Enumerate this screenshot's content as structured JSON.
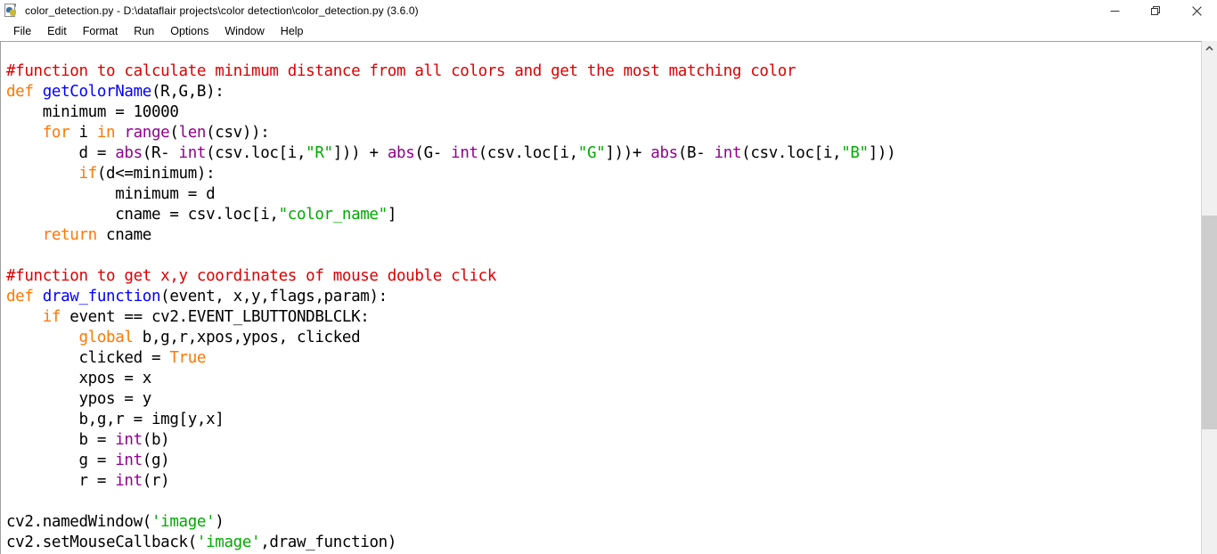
{
  "window": {
    "title": "color_detection.py - D:\\dataflair projects\\color detection\\color_detection.py (3.6.0)",
    "icon": "python-file-icon",
    "controls": {
      "minimize": "minimize-icon",
      "restore": "restore-icon",
      "close": "close-icon"
    }
  },
  "menubar": {
    "items": [
      {
        "label": "File"
      },
      {
        "label": "Edit"
      },
      {
        "label": "Format"
      },
      {
        "label": "Run"
      },
      {
        "label": "Options"
      },
      {
        "label": "Window"
      },
      {
        "label": "Help"
      }
    ]
  },
  "scrollbar": {
    "up_arrow": "chevron-up-icon",
    "thumb_top_pct": 32,
    "thumb_height_pct": 43
  },
  "colors": {
    "comment": "#dd0000",
    "keyword": "#ff7700",
    "definition": "#0000ff",
    "builtin": "#900090",
    "string": "#00aa00",
    "plain": "#000000",
    "background": "#ffffff"
  },
  "editor": {
    "language": "python",
    "lines": [
      [
        {
          "t": "#function to calculate minimum distance from all colors and get the most matching color",
          "c": "comment"
        }
      ],
      [
        {
          "t": "def",
          "c": "keyword"
        },
        {
          "t": " ",
          "c": "plain"
        },
        {
          "t": "getColorName",
          "c": "def"
        },
        {
          "t": "(R,G,B):",
          "c": "plain"
        }
      ],
      [
        {
          "t": "    minimum = 10000",
          "c": "plain"
        }
      ],
      [
        {
          "t": "    ",
          "c": "plain"
        },
        {
          "t": "for",
          "c": "keyword"
        },
        {
          "t": " i ",
          "c": "plain"
        },
        {
          "t": "in",
          "c": "keyword"
        },
        {
          "t": " ",
          "c": "plain"
        },
        {
          "t": "range",
          "c": "builtin"
        },
        {
          "t": "(",
          "c": "plain"
        },
        {
          "t": "len",
          "c": "builtin"
        },
        {
          "t": "(csv)):",
          "c": "plain"
        }
      ],
      [
        {
          "t": "        d = ",
          "c": "plain"
        },
        {
          "t": "abs",
          "c": "builtin"
        },
        {
          "t": "(R- ",
          "c": "plain"
        },
        {
          "t": "int",
          "c": "builtin"
        },
        {
          "t": "(csv.loc[i,",
          "c": "plain"
        },
        {
          "t": "\"R\"",
          "c": "string"
        },
        {
          "t": "])) + ",
          "c": "plain"
        },
        {
          "t": "abs",
          "c": "builtin"
        },
        {
          "t": "(G- ",
          "c": "plain"
        },
        {
          "t": "int",
          "c": "builtin"
        },
        {
          "t": "(csv.loc[i,",
          "c": "plain"
        },
        {
          "t": "\"G\"",
          "c": "string"
        },
        {
          "t": "]))+ ",
          "c": "plain"
        },
        {
          "t": "abs",
          "c": "builtin"
        },
        {
          "t": "(B- ",
          "c": "plain"
        },
        {
          "t": "int",
          "c": "builtin"
        },
        {
          "t": "(csv.loc[i,",
          "c": "plain"
        },
        {
          "t": "\"B\"",
          "c": "string"
        },
        {
          "t": "]))",
          "c": "plain"
        }
      ],
      [
        {
          "t": "        ",
          "c": "plain"
        },
        {
          "t": "if",
          "c": "keyword"
        },
        {
          "t": "(d<=minimum):",
          "c": "plain"
        }
      ],
      [
        {
          "t": "            minimum = d",
          "c": "plain"
        }
      ],
      [
        {
          "t": "            cname = csv.loc[i,",
          "c": "plain"
        },
        {
          "t": "\"color_name\"",
          "c": "string"
        },
        {
          "t": "]",
          "c": "plain"
        }
      ],
      [
        {
          "t": "    ",
          "c": "plain"
        },
        {
          "t": "return",
          "c": "keyword"
        },
        {
          "t": " cname",
          "c": "plain"
        }
      ],
      [
        {
          "t": "",
          "c": "plain"
        }
      ],
      [
        {
          "t": "#function to get x,y coordinates of mouse double click",
          "c": "comment"
        }
      ],
      [
        {
          "t": "def",
          "c": "keyword"
        },
        {
          "t": " ",
          "c": "plain"
        },
        {
          "t": "draw_function",
          "c": "def"
        },
        {
          "t": "(event, x,y,flags,param):",
          "c": "plain"
        }
      ],
      [
        {
          "t": "    ",
          "c": "plain"
        },
        {
          "t": "if",
          "c": "keyword"
        },
        {
          "t": " event == cv2.EVENT_LBUTTONDBLCLK:",
          "c": "plain"
        }
      ],
      [
        {
          "t": "        ",
          "c": "plain"
        },
        {
          "t": "global",
          "c": "keyword"
        },
        {
          "t": " b,g,r,xpos,ypos, clicked",
          "c": "plain"
        }
      ],
      [
        {
          "t": "        clicked = ",
          "c": "plain"
        },
        {
          "t": "True",
          "c": "keyword"
        }
      ],
      [
        {
          "t": "        xpos = x",
          "c": "plain"
        }
      ],
      [
        {
          "t": "        ypos = y",
          "c": "plain"
        }
      ],
      [
        {
          "t": "        b,g,r = img[y,x]",
          "c": "plain"
        }
      ],
      [
        {
          "t": "        b = ",
          "c": "plain"
        },
        {
          "t": "int",
          "c": "builtin"
        },
        {
          "t": "(b)",
          "c": "plain"
        }
      ],
      [
        {
          "t": "        g = ",
          "c": "plain"
        },
        {
          "t": "int",
          "c": "builtin"
        },
        {
          "t": "(g)",
          "c": "plain"
        }
      ],
      [
        {
          "t": "        r = ",
          "c": "plain"
        },
        {
          "t": "int",
          "c": "builtin"
        },
        {
          "t": "(r)",
          "c": "plain"
        }
      ],
      [
        {
          "t": "",
          "c": "plain"
        }
      ],
      [
        {
          "t": "cv2.namedWindow(",
          "c": "plain"
        },
        {
          "t": "'image'",
          "c": "string"
        },
        {
          "t": ")",
          "c": "plain"
        }
      ],
      [
        {
          "t": "cv2.setMouseCallback(",
          "c": "plain"
        },
        {
          "t": "'image'",
          "c": "string"
        },
        {
          "t": ",draw_function)",
          "c": "plain"
        }
      ]
    ]
  }
}
